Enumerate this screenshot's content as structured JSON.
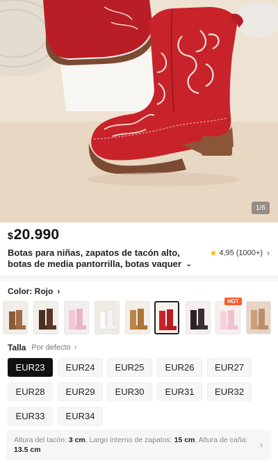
{
  "gallery": {
    "counter": "1/6"
  },
  "product": {
    "currency": "$",
    "price": "20.990",
    "title_line1": "Botas para niñas, zapatos de tacón alto,",
    "title_line2": "botas de media pantorrilla, botas vaquer",
    "rating_value": "4,95",
    "rating_count": "(1000+)"
  },
  "color": {
    "label": "Color: Rojo",
    "hot_badge": "HOT",
    "swatches": [
      "brown-boots",
      "dark-brown-boots",
      "pink-boots",
      "white-boots",
      "tan-boots",
      "red-boots",
      "black-boots",
      "pink-fur-boots",
      "beige-boots"
    ]
  },
  "size": {
    "label": "Talla",
    "default": "Por defecto",
    "options": [
      "EUR23",
      "EUR24",
      "EUR25",
      "EUR26",
      "EUR27",
      "EUR28",
      "EUR29",
      "EUR30",
      "EUR31",
      "EUR32",
      "EUR33",
      "EUR34"
    ],
    "selected": "EUR23"
  },
  "info": {
    "heel_label": "Altura del tacón:",
    "heel_value": "3 cm",
    "inner_label": "Largo interno de zapatos:",
    "inner_value": "15 cm",
    "shaft_label": "Altura de caña:",
    "shaft_value": "13.5 cm"
  },
  "colors": {
    "accent": "#ff5a2b",
    "boot_red": "#c8232b",
    "selected_size_bg": "#111111"
  }
}
